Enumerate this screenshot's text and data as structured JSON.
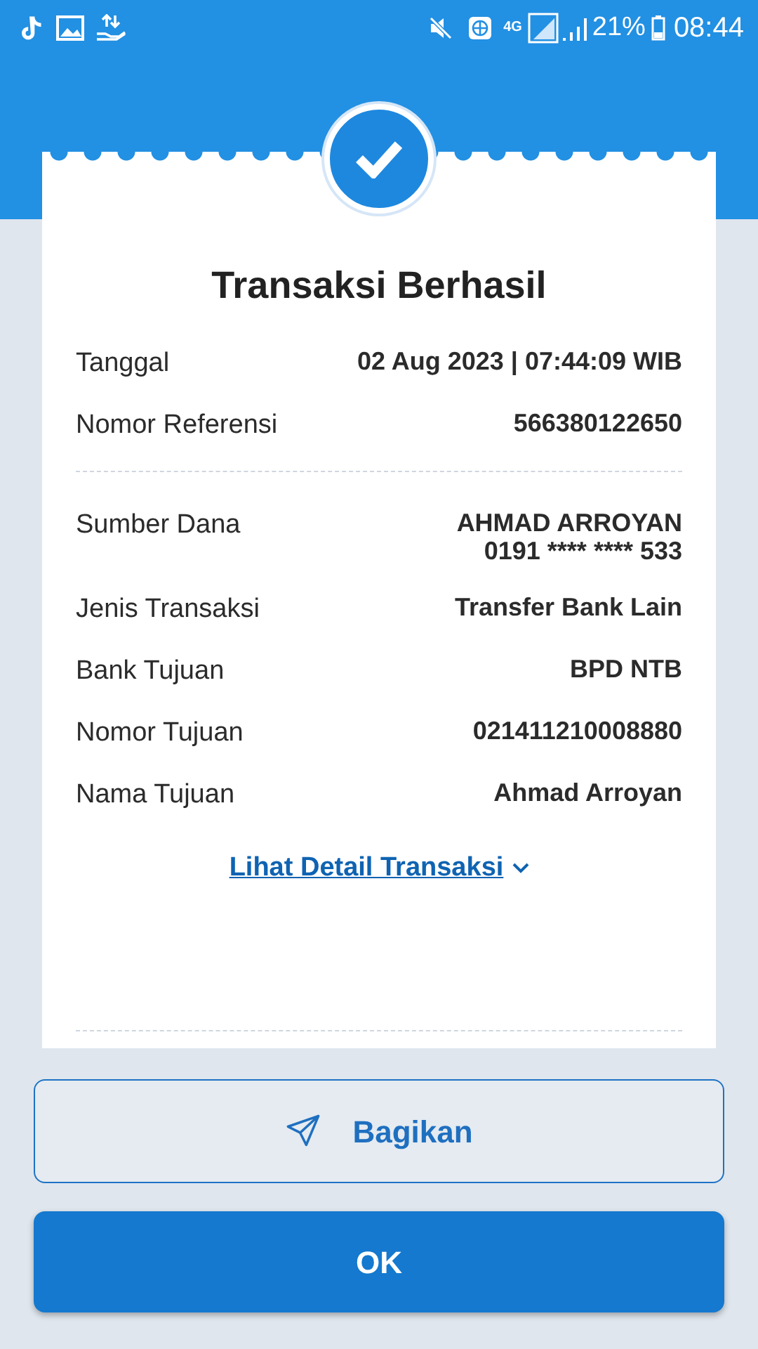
{
  "status_bar": {
    "network": "4G",
    "battery": "21%",
    "time": "08:44"
  },
  "receipt": {
    "title": "Transaksi Berhasil",
    "sections": [
      {
        "rows": [
          {
            "label": "Tanggal",
            "value": [
              "02 Aug 2023 | 07:44:09 WIB"
            ]
          },
          {
            "label": "Nomor Referensi",
            "value": [
              "566380122650"
            ]
          }
        ]
      },
      {
        "rows": [
          {
            "label": "Sumber Dana",
            "value": [
              "AHMAD ARROYAN",
              "0191 **** **** 533"
            ]
          },
          {
            "label": "Jenis Transaksi",
            "value": [
              "Transfer Bank Lain"
            ]
          },
          {
            "label": "Bank Tujuan",
            "value": [
              "BPD NTB"
            ]
          },
          {
            "label": "Nomor Tujuan",
            "value": [
              "021411210008880"
            ]
          },
          {
            "label": "Nama Tujuan",
            "value": [
              "Ahmad Arroyan"
            ]
          }
        ]
      }
    ],
    "detail_link": "Lihat Detail Transaksi"
  },
  "buttons": [
    {
      "kind": "outline",
      "label": "Bagikan"
    },
    {
      "kind": "primary",
      "label": "OK"
    }
  ]
}
